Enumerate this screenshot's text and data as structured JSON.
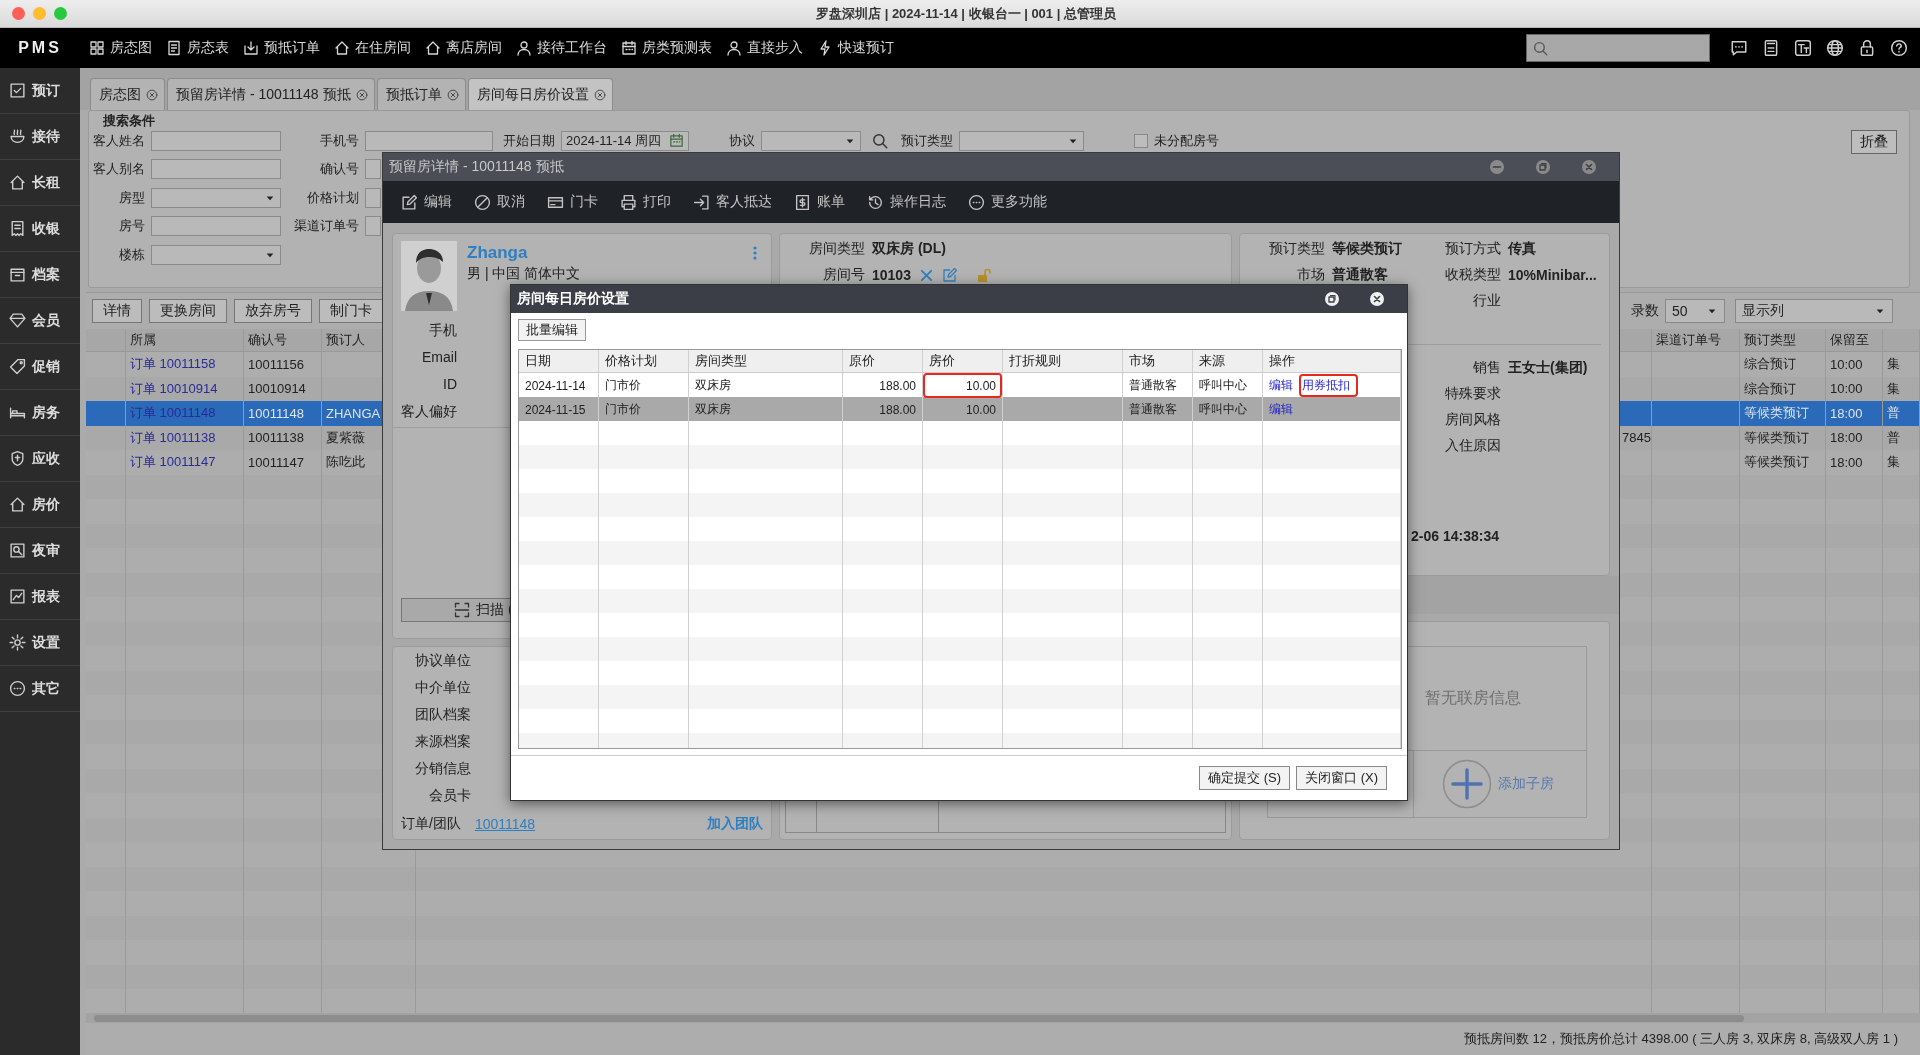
{
  "window": {
    "title": "罗盘深圳店 | 2024-11-14 | 收银台一 | 001 | 总管理员"
  },
  "nav": {
    "logo": "PMS",
    "items": [
      "房态图",
      "房态表",
      "预抵订单",
      "在住房间",
      "离店房间",
      "接待工作台",
      "房类预测表",
      "直接步入",
      "快速预订"
    ]
  },
  "sidebar": {
    "items": [
      "预订",
      "接待",
      "长租",
      "收银",
      "档案",
      "会员",
      "促销",
      "房务",
      "应收",
      "房价",
      "夜审",
      "报表",
      "设置",
      "其它"
    ]
  },
  "tabs": [
    {
      "label": "房态图",
      "selected": false
    },
    {
      "label": "预留房详情 - 10011148 预抵",
      "selected": false
    },
    {
      "label": "预抵订单",
      "selected": false
    },
    {
      "label": "房间每日房价设置",
      "selected": true
    }
  ],
  "search_panel": {
    "title": "搜索条件",
    "collapse_button": "折叠",
    "columns": [
      [
        {
          "label": "客人姓名",
          "kind": "text"
        },
        {
          "label": "客人别名",
          "kind": "text"
        },
        {
          "label": "房型",
          "kind": "select"
        },
        {
          "label": "房号",
          "kind": "text"
        },
        {
          "label": "楼栋",
          "kind": "select"
        }
      ],
      [
        {
          "label": "手机号",
          "kind": "text"
        },
        {
          "label": "确认号",
          "kind": "text"
        },
        {
          "label": "价格计划",
          "kind": "text"
        },
        {
          "label": "渠道订单号",
          "kind": "text"
        }
      ],
      [
        {
          "label": "开始日期",
          "kind": "date",
          "value": "2024-11-14 周四"
        }
      ],
      [
        {
          "label": "协议",
          "kind": "select_with_search"
        }
      ],
      [
        {
          "label": "预订类型",
          "kind": "select"
        }
      ],
      [
        {
          "label": "未分配房号",
          "kind": "checkbox",
          "checked": false
        }
      ]
    ]
  },
  "toolbar": {
    "buttons": [
      "详情",
      "更换房间",
      "放弃房号",
      "制门卡"
    ],
    "page_size": {
      "label": "录数",
      "value": "50"
    },
    "columns_select": "显示列"
  },
  "grid": {
    "columns": [
      {},
      {
        "label": "所属",
        "link": true
      },
      {
        "label": "确认号"
      },
      {
        "label": "预订人"
      },
      {},
      {
        "label": "渠道订单号"
      },
      {
        "label": "预订类型"
      },
      {
        "label": "保留至"
      },
      {}
    ],
    "rows": [
      {
        "selected": false,
        "cells": [
          null,
          "订单 10011158",
          "10011156",
          null,
          null,
          null,
          "综合预订",
          "10:00",
          "集"
        ]
      },
      {
        "selected": false,
        "cells": [
          null,
          "订单 10010914",
          "10010914",
          null,
          null,
          null,
          "综合预订",
          "10:00",
          "集"
        ]
      },
      {
        "selected": true,
        "cells": [
          null,
          "订单 10011148",
          "10011148",
          "ZHANGA",
          null,
          null,
          "等候类预订",
          "18:00",
          "普"
        ]
      },
      {
        "selected": false,
        "cells": [
          null,
          "订单 10011138",
          "10011138",
          "夏紫薇",
          "7845",
          null,
          "等候类预订",
          "18:00",
          "普"
        ]
      },
      {
        "selected": false,
        "cells": [
          null,
          "订单 10011147",
          "10011147",
          "陈吃此",
          null,
          null,
          "等候类预订",
          "18:00",
          "集"
        ]
      }
    ]
  },
  "status_bar": "预抵房间数 12，预抵房价总计 4398.00 ( 三人房 3, 双床房 8, 高级双人房 1 )",
  "detail_dialog": {
    "title": "预留房详情 - 10011148 预抵",
    "toolbar": [
      "编辑",
      "取消",
      "门卡",
      "打印",
      "客人抵达",
      "账单",
      "操作日志",
      "更多功能"
    ],
    "guest": {
      "name": "Zhanga",
      "info": "男 | 中国 简体中文",
      "fields": [
        "手机",
        "Email",
        "ID",
        "客人偏好"
      ],
      "scan_button": "扫描 ("
    },
    "profiles": {
      "fields": [
        "协议单位",
        "中介单位",
        "团队档案",
        "来源档案",
        "分销信息",
        "会员卡"
      ],
      "order_team": {
        "label": "订单/团队",
        "value": "10011148"
      },
      "join_team": "加入团队"
    },
    "room": [
      {
        "label": "房间类型",
        "value": "双床房 (DL)"
      },
      {
        "label": "房间号",
        "value": "10103"
      }
    ],
    "booking": {
      "left": [
        {
          "label": "预订类型",
          "value": "等候类预订"
        },
        {
          "label": "市场",
          "value": "普通散客"
        }
      ],
      "right": [
        {
          "label": "预订方式",
          "value": "传真"
        },
        {
          "label": "收税类型",
          "value": "10%Minibar..."
        },
        {
          "label": "行业"
        }
      ]
    },
    "details": [
      {
        "label": "销售",
        "value": "王女士(集团)"
      },
      {
        "label": "特殊要求"
      },
      {
        "label": "房间风格"
      },
      {
        "label": "入住原因"
      }
    ],
    "timestamp": "2-06 14:38:34",
    "linked_rooms": {
      "empty_text": "暂无联房信息",
      "add_button": "添加子房"
    }
  },
  "rate_dialog": {
    "title": "房间每日房价设置",
    "batch_button": "批量编辑",
    "columns": [
      "日期",
      "价格计划",
      "房间类型",
      "原价",
      "房价",
      "打折规则",
      "市场",
      "来源",
      "操作"
    ],
    "rows": [
      {
        "selected": false,
        "price_highlighted": true,
        "cells": [
          "2024-11-14",
          "门市价",
          "双床房",
          "188.00",
          "10.00",
          null,
          "普通散客",
          "呼叫中心"
        ],
        "actions": [
          {
            "label": "编辑",
            "highlighted": false
          },
          {
            "label": "用券抵扣",
            "highlighted": true
          }
        ]
      },
      {
        "selected": true,
        "price_highlighted": false,
        "cells": [
          "2024-11-15",
          "门市价",
          "双床房",
          "188.00",
          "10.00",
          null,
          "普通散客",
          "呼叫中心"
        ],
        "actions": [
          {
            "label": "编辑",
            "highlighted": false
          }
        ]
      }
    ],
    "buttons": [
      "确定提交 (S)",
      "关闭窗口 (X)"
    ]
  }
}
